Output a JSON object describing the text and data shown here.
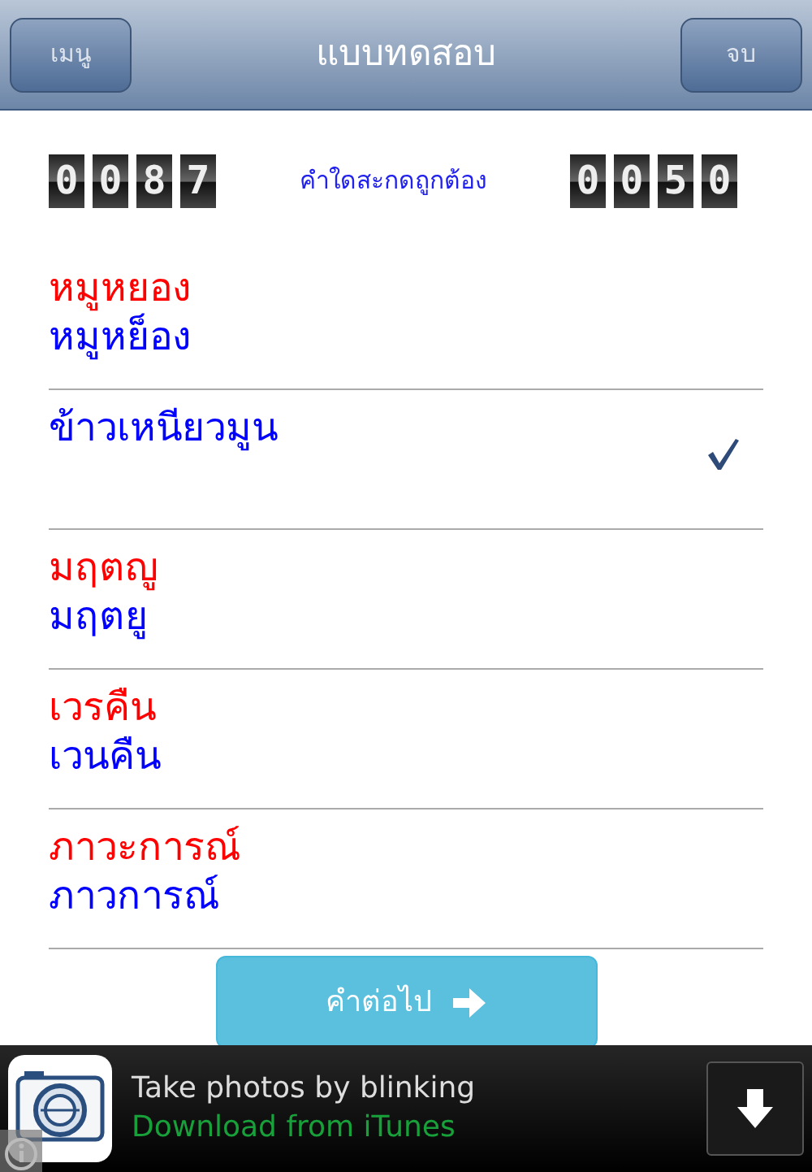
{
  "navbar": {
    "left_button": "เมนู",
    "title": "แบบทดสอบ",
    "right_button": "จบ"
  },
  "score": {
    "left_counter": [
      "0",
      "0",
      "8",
      "7"
    ],
    "label": "คำใดสะกดถูกต้อง",
    "right_counter": [
      "0",
      "0",
      "5",
      "0"
    ]
  },
  "rows": [
    {
      "checked": false,
      "lines": [
        {
          "text": "หมูหยอง",
          "color": "#ff0000"
        },
        {
          "text": "หมูหย็อง",
          "color": "#0000ff"
        }
      ]
    },
    {
      "checked": true,
      "lines": [
        {
          "text": "ข้าวเหนียวมูน",
          "color": "#0000ff"
        }
      ]
    },
    {
      "checked": false,
      "lines": [
        {
          "text": "มฤตญู",
          "color": "#ff0000"
        },
        {
          "text": "มฤตยู",
          "color": "#0000ff"
        }
      ]
    },
    {
      "checked": false,
      "lines": [
        {
          "text": "เวรคืน",
          "color": "#ff0000"
        },
        {
          "text": "เวนคืน",
          "color": "#0000ff"
        }
      ]
    },
    {
      "checked": false,
      "lines": [
        {
          "text": "ภาวะการณ์",
          "color": "#ff0000"
        },
        {
          "text": "ภาวการณ์",
          "color": "#0000ff"
        }
      ]
    }
  ],
  "next_button": "คำต่อไป",
  "ad": {
    "title": "Take photos by blinking",
    "subtitle": "Download from iTunes"
  }
}
